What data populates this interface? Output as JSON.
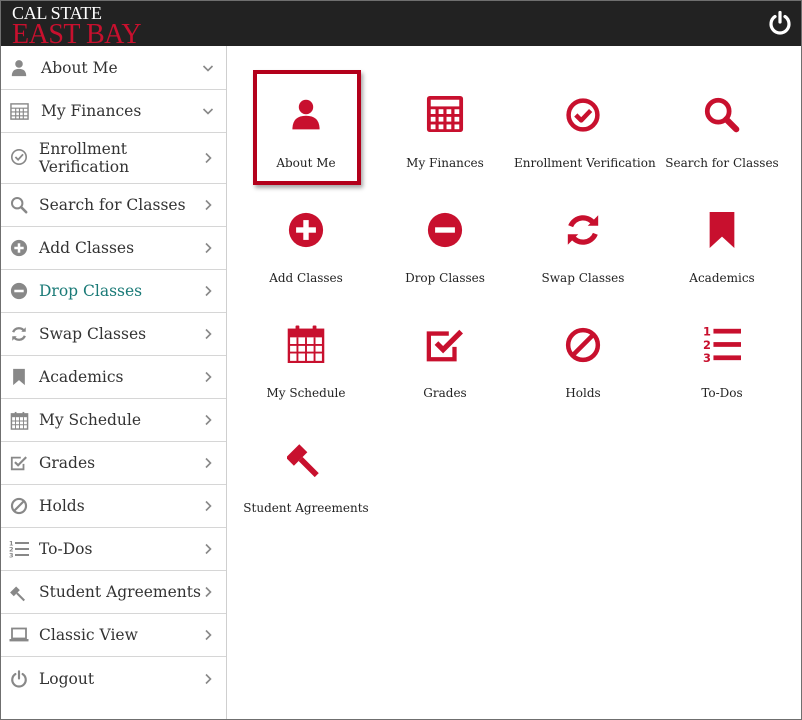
{
  "header": {
    "logo_top": "CAL STATE",
    "logo_bottom": "EAST BAY",
    "power_icon": "power-icon"
  },
  "colors": {
    "brand_red": "#c8102e",
    "header_bg": "#222222",
    "active_teal": "#1a7a77",
    "sidebar_icon": "#888888"
  },
  "sidebar": {
    "items": [
      {
        "label": "About Me",
        "icon": "user-icon",
        "chevron": "chevron-down-icon"
      },
      {
        "label": "My Finances",
        "icon": "calculator-icon",
        "chevron": "chevron-down-icon"
      },
      {
        "label": "Enrollment Verification",
        "icon": "check-circle-icon",
        "chevron": "chevron-right-icon"
      },
      {
        "label": "Search for Classes",
        "icon": "search-icon",
        "chevron": "chevron-right-icon"
      },
      {
        "label": "Add Classes",
        "icon": "plus-circle-icon",
        "chevron": "chevron-right-icon"
      },
      {
        "label": "Drop Classes",
        "icon": "minus-circle-icon",
        "chevron": "chevron-right-icon",
        "active": true
      },
      {
        "label": "Swap Classes",
        "icon": "refresh-icon",
        "chevron": "chevron-right-icon"
      },
      {
        "label": "Academics",
        "icon": "bookmark-icon",
        "chevron": "chevron-right-icon"
      },
      {
        "label": "My Schedule",
        "icon": "calendar-icon",
        "chevron": "chevron-right-icon"
      },
      {
        "label": "Grades",
        "icon": "check-square-icon",
        "chevron": "chevron-right-icon"
      },
      {
        "label": "Holds",
        "icon": "ban-icon",
        "chevron": "chevron-right-icon"
      },
      {
        "label": "To-Dos",
        "icon": "numbered-list-icon",
        "chevron": "chevron-right-icon"
      },
      {
        "label": "Student Agreements",
        "icon": "gavel-icon",
        "chevron": "chevron-right-icon"
      },
      {
        "label": "Classic View",
        "icon": "laptop-icon",
        "chevron": "chevron-right-icon"
      },
      {
        "label": "Logout",
        "icon": "power-icon",
        "chevron": "chevron-right-icon"
      }
    ],
    "enrollment_line1": "Enrollment",
    "enrollment_line2": "Verification"
  },
  "main": {
    "tiles": [
      {
        "label": "About Me",
        "icon": "user-icon",
        "selected": true
      },
      {
        "label": "My Finances",
        "icon": "calculator-icon"
      },
      {
        "label": "Enrollment Verification",
        "icon": "check-circle-icon"
      },
      {
        "label": "Search for Classes",
        "icon": "search-icon"
      },
      {
        "label": "Add Classes",
        "icon": "plus-circle-icon"
      },
      {
        "label": "Drop Classes",
        "icon": "minus-circle-icon"
      },
      {
        "label": "Swap Classes",
        "icon": "refresh-icon"
      },
      {
        "label": "Academics",
        "icon": "bookmark-icon"
      },
      {
        "label": "My Schedule",
        "icon": "calendar-icon"
      },
      {
        "label": "Grades",
        "icon": "check-square-icon"
      },
      {
        "label": "Holds",
        "icon": "ban-icon"
      },
      {
        "label": "To-Dos",
        "icon": "numbered-list-icon"
      },
      {
        "label": "Student Agreements",
        "icon": "gavel-icon"
      }
    ]
  }
}
